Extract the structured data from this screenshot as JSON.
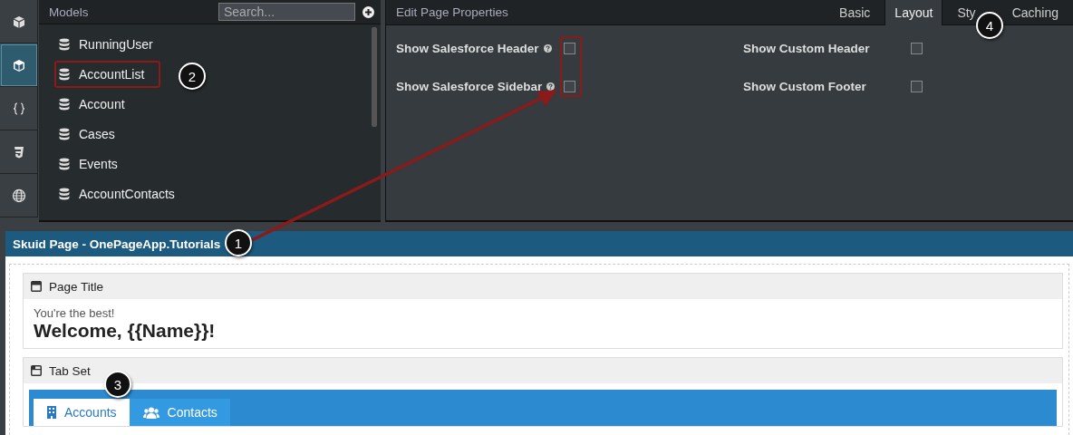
{
  "rail": [
    {
      "selected": false
    },
    {
      "selected": true
    },
    {
      "selected": false
    },
    {
      "selected": false
    },
    {
      "selected": false
    }
  ],
  "models": {
    "title": "Models",
    "search": {
      "placeholder": "Search..."
    },
    "items": [
      {
        "label": "RunningUser",
        "highlighted": false
      },
      {
        "label": "AccountList",
        "highlighted": true
      },
      {
        "label": "Account",
        "highlighted": false
      },
      {
        "label": "Cases",
        "highlighted": false
      },
      {
        "label": "Events",
        "highlighted": false
      },
      {
        "label": "AccountContacts",
        "highlighted": false
      }
    ]
  },
  "properties": {
    "title": "Edit Page Properties",
    "tabs": [
      {
        "label": "Basic",
        "selected": false
      },
      {
        "label": "Layout",
        "selected": true
      },
      {
        "label": "Sty",
        "selected": false
      },
      {
        "label": "Caching",
        "selected": false
      }
    ],
    "checkbox_column_highlighted": true,
    "fields": [
      {
        "label": "Show Salesforce Header",
        "help": true,
        "checked": false
      },
      {
        "label": "Show Custom Header",
        "help": false,
        "checked": false
      },
      {
        "label": "Show Salesforce Sidebar",
        "help": true,
        "checked": false
      },
      {
        "label": "Show Custom Footer",
        "help": false,
        "checked": false
      }
    ]
  },
  "page": {
    "title": "Skuid Page - OnePageApp.Tutorials",
    "page_title": {
      "heading": "Page Title",
      "subtitle": "You're the best!",
      "title": "Welcome, {{Name}}!"
    },
    "tab_set": {
      "heading": "Tab Set",
      "tabs": [
        {
          "label": "Accounts",
          "selected": true
        },
        {
          "label": "Contacts",
          "selected": false
        }
      ]
    }
  },
  "callouts": [
    "1",
    "2",
    "3",
    "4"
  ]
}
